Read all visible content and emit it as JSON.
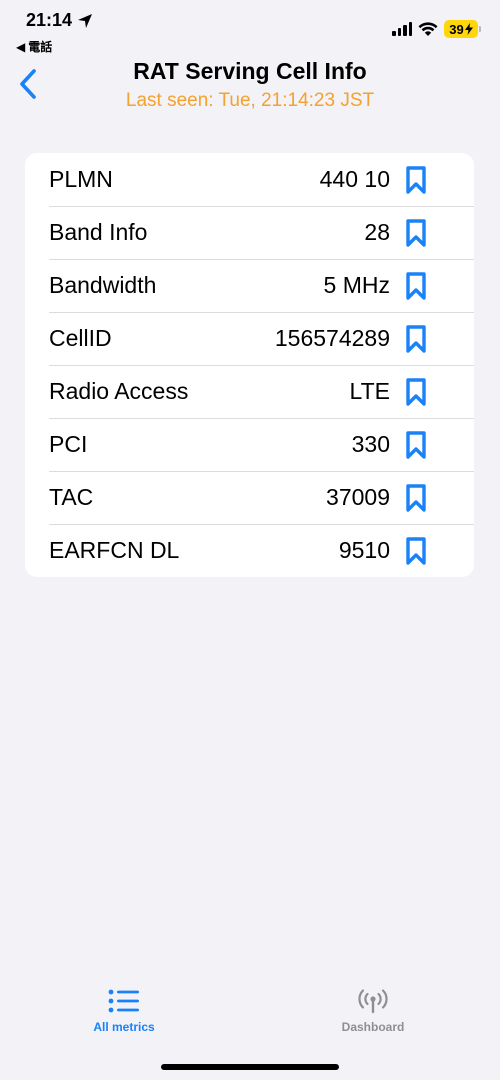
{
  "status_bar": {
    "time": "21:14",
    "back_app": "電話",
    "battery": "39"
  },
  "nav": {
    "title": "RAT Serving Cell Info",
    "subtitle": "Last seen: Tue, 21:14:23 JST"
  },
  "rows": [
    {
      "label": "PLMN",
      "value": "440 10"
    },
    {
      "label": "Band Info",
      "value": "28"
    },
    {
      "label": "Bandwidth",
      "value": "5 MHz"
    },
    {
      "label": "CellID",
      "value": "156574289"
    },
    {
      "label": "Radio Access",
      "value": "LTE"
    },
    {
      "label": "PCI",
      "value": "330"
    },
    {
      "label": "TAC",
      "value": "37009"
    },
    {
      "label": "EARFCN DL",
      "value": "9510"
    }
  ],
  "tabbar": {
    "tabs": [
      {
        "label": "All metrics",
        "icon": "list-icon",
        "active": true
      },
      {
        "label": "Dashboard",
        "icon": "antenna-icon",
        "active": false
      }
    ]
  },
  "colors": {
    "accent": "#1a82f7",
    "subtitle": "#f4a12e",
    "background": "#f2f2f7",
    "battery": "#ffd60a"
  }
}
